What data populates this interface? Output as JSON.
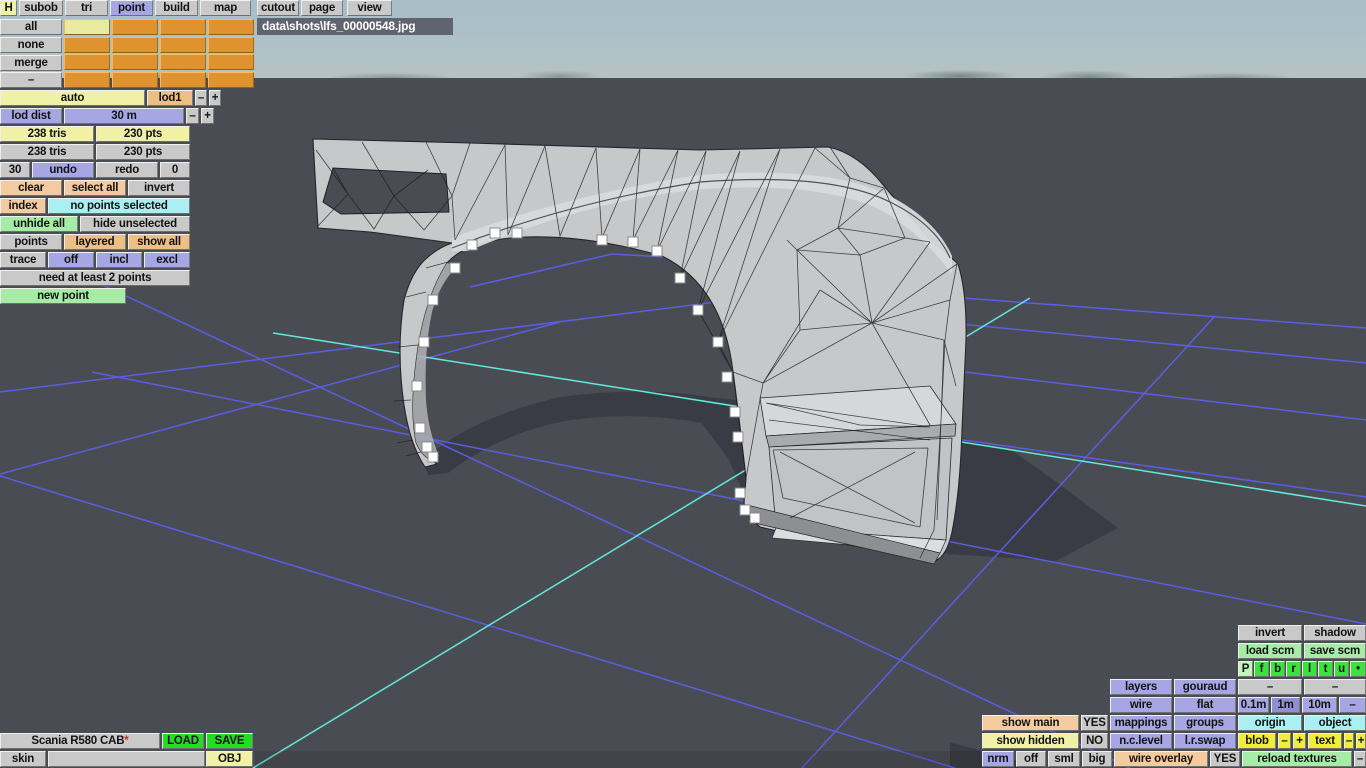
{
  "menu": {
    "h": "H",
    "tabs": [
      "subob",
      "tri",
      "point",
      "build",
      "map",
      "cutout",
      "page",
      "view"
    ]
  },
  "subobj": {
    "rows": [
      "all",
      "none",
      "merge",
      "–"
    ]
  },
  "file_path": "data\\shots\\lfs_00000548.jpg",
  "lod": {
    "auto": "auto",
    "lod1": "lod1",
    "minus": "–",
    "plus": "+",
    "lod_dist": "lod dist",
    "dist_value": "30 m",
    "tris_a": "238 tris",
    "pts_a": "230 pts",
    "tris_b": "238 tris",
    "pts_b": "230 pts"
  },
  "history": {
    "count": "30",
    "undo": "undo",
    "redo": "redo",
    "zero": "0"
  },
  "selection": {
    "clear": "clear",
    "select_all": "select all",
    "invert": "invert",
    "index": "index",
    "status": "no points selected",
    "unhide_all": "unhide all",
    "hide_unselected": "hide unselected",
    "points": "points",
    "layered": "layered",
    "show_all": "show all",
    "trace": "trace",
    "off": "off",
    "incl": "incl",
    "excl": "excl",
    "hint": "need at least 2 points",
    "new_point": "new point"
  },
  "model": {
    "name": "Scania R580 CAB",
    "star": "*",
    "load": "LOAD",
    "save": "SAVE",
    "skin": "skin",
    "obj": "OBJ"
  },
  "right": {
    "invert": "invert",
    "shadow": "shadow",
    "load_scm": "load scm",
    "save_scm": "save scm",
    "letters": [
      "P",
      "f",
      "b",
      "r",
      "l",
      "t",
      "u",
      "•"
    ],
    "layers": "layers",
    "gouraud": "gouraud",
    "dash1": "–",
    "dash2": "–",
    "wire": "wire",
    "flat": "flat",
    "m01": "0.1m",
    "m1": "1m",
    "m10": "10m",
    "mdash": "–",
    "show_main": "show main",
    "yes1": "YES",
    "mappings": "mappings",
    "groups": "groups",
    "origin": "origin",
    "object": "object",
    "show_hidden": "show hidden",
    "no": "NO",
    "nclevel": "n.c.level",
    "lrswap": "l.r.swap",
    "blob": "blob",
    "bminus": "–",
    "bplus": "+",
    "text": "text",
    "tminus": "–",
    "tplus": "+",
    "nrm": "nrm",
    "off": "off",
    "sml": "sml",
    "big": "big",
    "wire_overlay": "wire overlay",
    "yes2": "YES",
    "reload_textures": "reload textures",
    "rdash": "–"
  },
  "colors": {
    "viewport_bg": "#4a4c53",
    "shadow": "#3a3c45",
    "grid_blue": "#5a5ee3",
    "grid_cyan": "#62e9da",
    "mesh_gray": "#c7c8ca",
    "accent_orange": "#e0922e",
    "accent_purple": "#a6a6e4",
    "accent_green": "#22dd22",
    "accent_yellow": "#f0ee38",
    "status_cyan": "#aaf0f2",
    "star_red": "#e02020"
  }
}
